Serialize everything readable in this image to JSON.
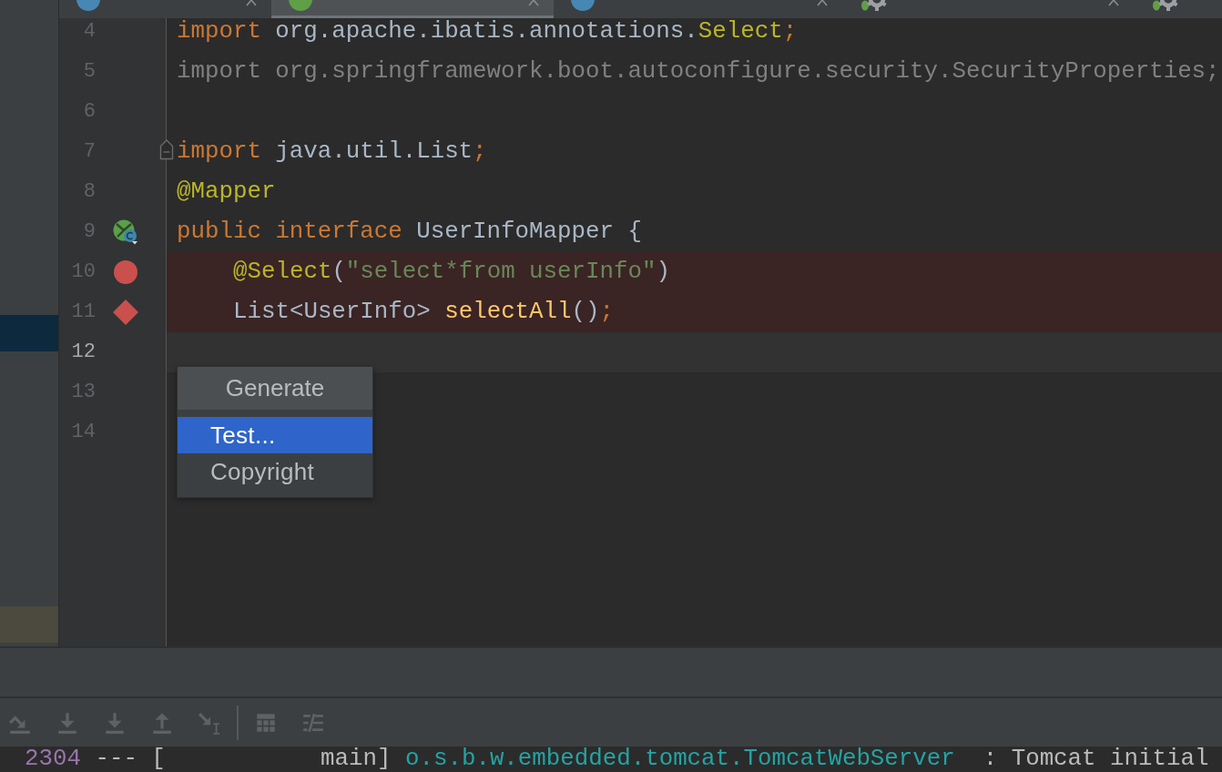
{
  "tabs": [
    {
      "kind": "class",
      "selected": false,
      "closable": true
    },
    {
      "kind": "interface",
      "selected": true,
      "closable": true
    },
    {
      "kind": "class",
      "selected": false,
      "closable": true
    },
    {
      "kind": "properties",
      "selected": false,
      "closable": true
    },
    {
      "kind": "properties",
      "selected": false,
      "closable": false
    }
  ],
  "project_panel": {
    "rows": [
      {
        "selected": false
      },
      {
        "selected": false
      },
      {
        "selected": false
      },
      {
        "selected": false
      },
      {
        "selected": false
      },
      {
        "selected": false
      },
      {
        "selected": false
      },
      {
        "selected": false
      },
      {
        "selected": true
      },
      {
        "selected": false
      },
      {
        "selected": false
      },
      {
        "selected": false
      },
      {
        "selected": false
      },
      {
        "selected": false
      },
      {
        "selected": false
      },
      {
        "selected": false
      },
      {
        "selected": false,
        "color": "#4c4a3e"
      }
    ]
  },
  "editor": {
    "lines": [
      {
        "number": "4",
        "current": false,
        "breakpoint": false,
        "fold": false,
        "tokens": [
          {
            "kind": "keyword",
            "text": "import"
          },
          {
            "kind": "plain",
            "text": " org.apache.ibatis.annotations."
          },
          {
            "kind": "annotation",
            "text": "Select"
          },
          {
            "kind": "keyword",
            "text": ";"
          }
        ]
      },
      {
        "number": "5",
        "current": false,
        "breakpoint": false,
        "fold": false,
        "tokens": [
          {
            "kind": "unused",
            "text": "import org.springframework.boot.autoconfigure.security.SecurityProperties;"
          }
        ]
      },
      {
        "number": "6",
        "current": false,
        "breakpoint": false,
        "fold": false
      },
      {
        "number": "7",
        "current": false,
        "breakpoint": false,
        "fold": true,
        "tokens": [
          {
            "kind": "keyword",
            "text": "import"
          },
          {
            "kind": "plain",
            "text": " java.util.List"
          },
          {
            "kind": "keyword",
            "text": ";"
          }
        ]
      },
      {
        "number": "8",
        "current": false,
        "breakpoint": false,
        "fold": false,
        "tokens": [
          {
            "kind": "annotation",
            "text": "@Mapper"
          }
        ]
      },
      {
        "number": "9",
        "current": false,
        "breakpoint": false,
        "fold": false,
        "marker": {
          "kind": "implementation"
        },
        "tokens": [
          {
            "kind": "keyword",
            "text": "public "
          },
          {
            "kind": "keyword",
            "text": "interface"
          },
          {
            "kind": "plain",
            "text": " UserInfoMapper {"
          }
        ],
        "children": [
          {
            "number": "10",
            "current": false,
            "breakpoint": true,
            "fold": false,
            "marker": {
              "kind": "breakpoint"
            },
            "tokens": [
              {
                "kind": "annotation",
                "text": "@Select"
              },
              {
                "kind": "plain",
                "text": "("
              },
              {
                "kind": "string",
                "text": "\"select*from userInfo\""
              },
              {
                "kind": "plain",
                "text": ")"
              }
            ]
          },
          {
            "number": "11",
            "current": false,
            "breakpoint": true,
            "fold": false,
            "marker": {
              "kind": "method-breakpoint"
            },
            "tokens": [
              {
                "kind": "plain",
                "text": "List<UserInfo> "
              },
              {
                "kind": "method",
                "text": "selectAll"
              },
              {
                "kind": "plain",
                "text": "()"
              },
              {
                "kind": "keyword",
                "text": ";"
              }
            ]
          }
        ]
      },
      {
        "number": "12",
        "current": true,
        "breakpoint": false,
        "fold": false
      },
      {
        "number": "13",
        "current": false,
        "breakpoint": false,
        "fold": false
      },
      {
        "number": "14",
        "current": false,
        "breakpoint": false,
        "fold": false
      }
    ]
  },
  "popup": {
    "title": "Generate",
    "items": [
      {
        "label": "Test...",
        "selected": true
      },
      {
        "label": "Copyright",
        "selected": false
      }
    ]
  },
  "debug_toolbar": {
    "groups": [
      {
        "buttons": [
          {
            "kind": "step-over",
            "disabled": true
          },
          {
            "kind": "step-into",
            "disabled": true
          },
          {
            "kind": "force-step-into",
            "disabled": true
          },
          {
            "kind": "step-out",
            "disabled": true
          },
          {
            "kind": "run-to-cursor",
            "disabled": true
          }
        ]
      },
      {
        "buttons": [
          {
            "kind": "evaluate",
            "disabled": true
          },
          {
            "kind": "trace",
            "disabled": true
          }
        ]
      }
    ]
  },
  "console": {
    "tokens": [
      {
        "kind": "pid",
        "text": "2304"
      },
      {
        "kind": "plain",
        "text": " --- [           main] "
      },
      {
        "kind": "logger",
        "text": "o.s.b.w.embedded.tomcat.TomcatWebServer"
      },
      {
        "kind": "plain",
        "text": "  : Tomcat initial"
      }
    ]
  }
}
